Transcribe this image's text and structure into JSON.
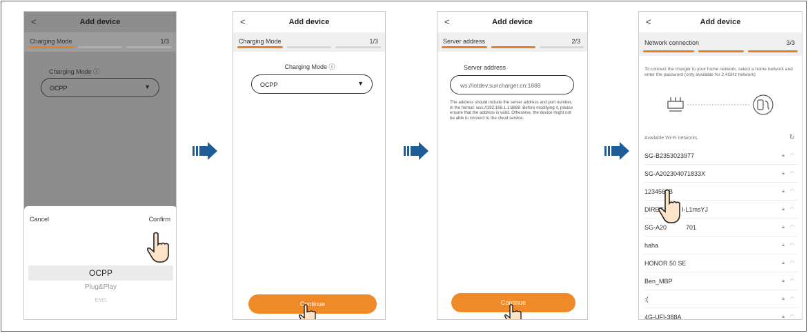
{
  "screens": [
    {
      "title": "Add device",
      "back": "<",
      "step_name": "Charging Mode",
      "step_count": "1/3",
      "field_label": "Charging Mode",
      "selected": "OCPP",
      "picker": {
        "cancel": "Cancel",
        "confirm": "Confirm",
        "options": [
          "OCPP",
          "Plug&Play",
          "EMS"
        ]
      }
    },
    {
      "title": "Add device",
      "back": "<",
      "step_name": "Charging Mode",
      "step_count": "1/3",
      "field_label": "Charging Mode",
      "selected": "OCPP",
      "continue": "Continue"
    },
    {
      "title": "Add device",
      "back": "<",
      "step_name": "Server address",
      "step_count": "2/3",
      "field_label": "Server address",
      "address": "ws://iotdev.suncharger.cn:1888",
      "hint": "The address should include the server address and port number, in the format: wss://192.168.1.1:8888. Before modifying it, please ensure that the address is valid. Otherwise, the device might not be able to connect to the cloud service.",
      "continue": "Continue"
    },
    {
      "title": "Add device",
      "back": "<",
      "step_name": "Network connection",
      "step_count": "3/3",
      "description": "To connect the charger to your home network, select a home network and enter the password (only available for 2.4GHz network)",
      "available_label": "Available Wi-Fi networks",
      "networks": [
        "SG-B2353023977",
        "SG-A202304071833X",
        "1234568",
        "DIREC",
        "SG-A20",
        "haha",
        "HONOR 50 SE",
        "Ben_MBP",
        ":(",
        "4G-UFI-388A"
      ],
      "network_suffixes": [
        "",
        "",
        "B",
        "I-L1msYJ",
        "701",
        "",
        "",
        "",
        "",
        ""
      ]
    }
  ],
  "colors": {
    "accent": "#e8801e",
    "arrow": "#1f5d99",
    "overlay": "#8d8d8d"
  }
}
